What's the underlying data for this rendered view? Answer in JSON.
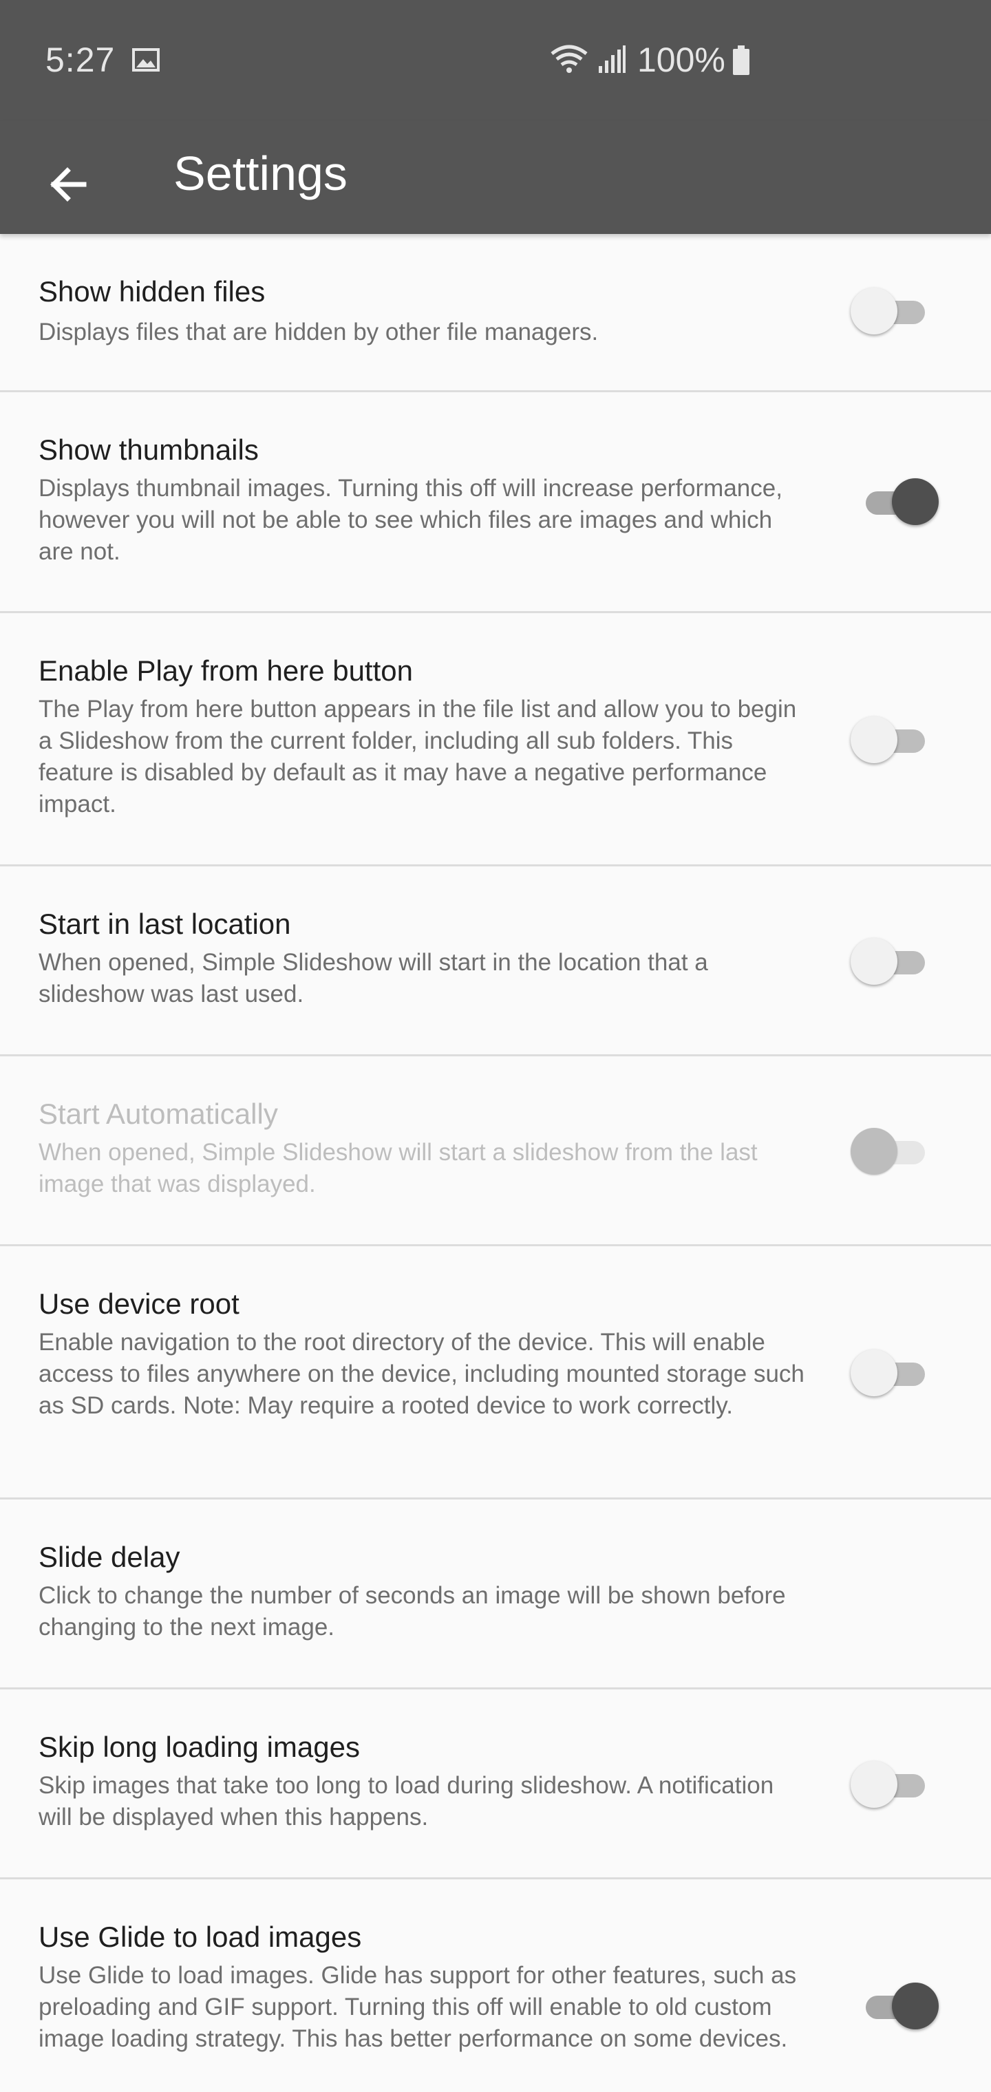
{
  "status_bar": {
    "time": "5:27",
    "battery": "100%"
  },
  "app_bar": {
    "title": "Settings",
    "back_icon": "arrow-left-icon"
  },
  "settings": [
    {
      "title": "Show hidden files",
      "desc": "Displays files that are hidden by other file managers.",
      "toggle": false,
      "enabled": true
    },
    {
      "title": "Show thumbnails",
      "desc": "Displays thumbnail images. Turning this off will increase performance, however you will not be able to see which files are images and which are not.",
      "toggle": true,
      "enabled": true
    },
    {
      "title": "Enable Play from here button",
      "desc": "The Play from here button appears in the file list and allow you to begin a Slideshow from the current folder, including all sub folders. This feature is disabled by default as it may have a negative performance impact.",
      "toggle": false,
      "enabled": true
    },
    {
      "title": "Start in last location",
      "desc": "When opened, Simple Slideshow will start in the location that a slideshow was last used.",
      "toggle": false,
      "enabled": true
    },
    {
      "title": "Start Automatically",
      "desc": "When opened, Simple Slideshow will start a slideshow from the last image that was displayed.",
      "toggle": false,
      "enabled": false
    },
    {
      "title": "Use device root",
      "desc": "Enable navigation to the root directory of the device. This will enable access to files anywhere on the device, including mounted storage such as SD cards. Note: May require a rooted device to work correctly.",
      "toggle": false,
      "enabled": true
    },
    {
      "title": "Slide delay",
      "desc": "Click to change the number of seconds an image will be shown before changing to the next image."
    },
    {
      "title": "Skip long loading images",
      "desc": "Skip images that take too long to load during slideshow. A notification will be displayed when this happens.",
      "toggle": false,
      "enabled": true
    },
    {
      "title": "Use Glide to load images",
      "desc": "Use Glide to load images. Glide has support for other features, such as preloading and GIF support. Turning this off will enable to old custom image loading strategy. This has better performance on some devices.",
      "toggle": true,
      "enabled": true
    }
  ],
  "colors": {
    "bar": "#555555",
    "background": "#fafafa",
    "divider": "#dcdcdc",
    "switch_on_thumb": "#4f4f4f"
  }
}
